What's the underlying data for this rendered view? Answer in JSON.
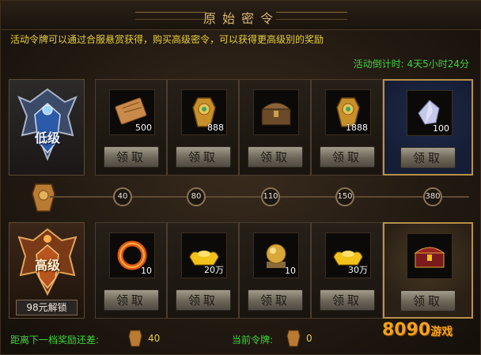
{
  "title": "原始密令",
  "notice": "活动令牌可以通过合服悬赏获得，购买高级密令，可以获得更高级别的奖励",
  "countdown": {
    "label": "活动倒计时:",
    "value": "4天5小时24分"
  },
  "low_tier": {
    "badge_text": "低级",
    "rewards": [
      {
        "icon": "scroll-icon",
        "qty": "500",
        "button": "领取"
      },
      {
        "icon": "gold-token-icon",
        "qty": "888",
        "button": "领取"
      },
      {
        "icon": "treasure-chest-icon",
        "qty": "",
        "button": "领取"
      },
      {
        "icon": "gold-token-icon",
        "qty": "1888",
        "button": "领取"
      },
      {
        "icon": "crystal-icon",
        "qty": "100",
        "button": "领取"
      }
    ]
  },
  "milestones": [
    "40",
    "80",
    "110",
    "150",
    "380"
  ],
  "high_tier": {
    "badge_text": "高级",
    "unlock_label": "98元解锁",
    "rewards": [
      {
        "icon": "fire-ring-icon",
        "qty": "10",
        "button": "领取"
      },
      {
        "icon": "gold-ingot-icon",
        "qty": "20万",
        "button": "领取"
      },
      {
        "icon": "golden-orb-icon",
        "qty": "10",
        "button": "领取"
      },
      {
        "icon": "gold-ingot-icon",
        "qty": "30万",
        "button": "领取"
      },
      {
        "icon": "ornate-chest-icon",
        "qty": "",
        "button": "领取"
      }
    ]
  },
  "footer": {
    "next_label": "距离下一档奖励还差:",
    "next_value": "40",
    "current_label": "当前令牌:",
    "current_value": "0"
  },
  "watermark": {
    "main": "8090",
    "suffix": "游戏"
  }
}
